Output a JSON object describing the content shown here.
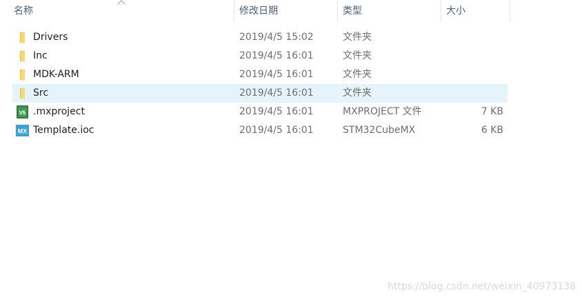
{
  "columns": {
    "name": "名称",
    "modified": "修改日期",
    "type": "类型",
    "size": "大小"
  },
  "sort": {
    "column": "name",
    "direction": "ascending",
    "icon": "sort-up-icon"
  },
  "files": [
    {
      "name": "Drivers",
      "modified": "2019/4/5 15:02",
      "type": "文件夹",
      "size": "",
      "icon": "folder-icon",
      "selected": false
    },
    {
      "name": "Inc",
      "modified": "2019/4/5 16:01",
      "type": "文件夹",
      "size": "",
      "icon": "folder-icon",
      "selected": false
    },
    {
      "name": "MDK-ARM",
      "modified": "2019/4/5 16:01",
      "type": "文件夹",
      "size": "",
      "icon": "folder-icon",
      "selected": false
    },
    {
      "name": "Src",
      "modified": "2019/4/5 16:01",
      "type": "文件夹",
      "size": "",
      "icon": "folder-icon",
      "selected": true
    },
    {
      "name": ".mxproject",
      "modified": "2019/4/5 16:01",
      "type": "MXPROJECT 文件",
      "size": "7 KB",
      "icon": "mxproject-file-icon",
      "selected": false
    },
    {
      "name": "Template.ioc",
      "modified": "2019/4/5 16:01",
      "type": "STM32CubeMX",
      "size": "6 KB",
      "icon": "stm32cubemx-file-icon",
      "selected": false
    }
  ],
  "icon_labels": {
    "mx_badge": "MX",
    "v5_badge": "V5"
  },
  "colors": {
    "selection": "#e5f3fb",
    "header_text": "#4c607a",
    "folder_yellow": "#f8d775",
    "mx_blue": "#3ca1d6",
    "v5_green": "#2e7d3c"
  },
  "watermark": "https://blog.csdn.net/weixin_40973138"
}
